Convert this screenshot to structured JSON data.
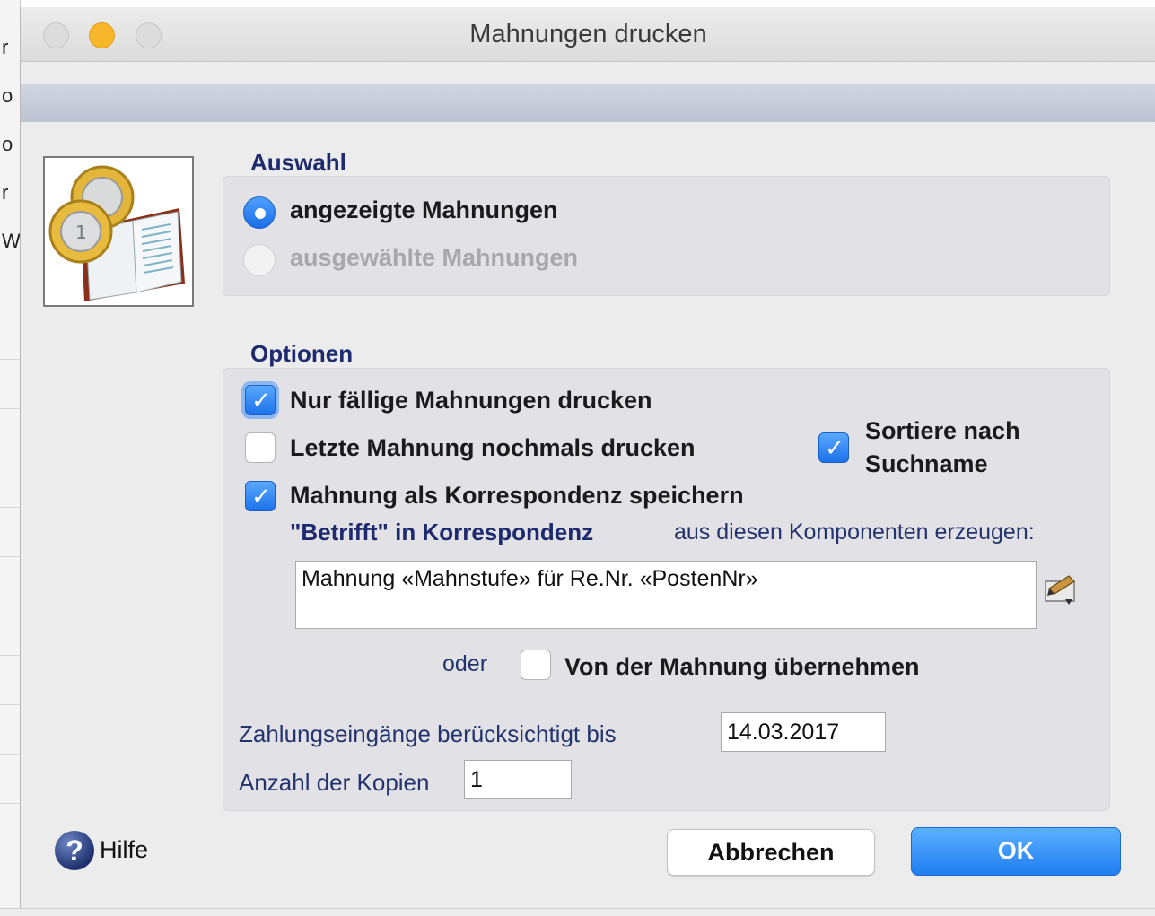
{
  "background_app": {
    "letters": [
      "r",
      "o",
      "o",
      "r",
      "Wi"
    ]
  },
  "window": {
    "title": "Mahnungen drucken"
  },
  "auswahl": {
    "title": "Auswahl",
    "options": [
      {
        "label": "angezeigte Mahnungen",
        "selected": true,
        "enabled": true
      },
      {
        "label": "ausgewählte Mahnungen",
        "selected": false,
        "enabled": false
      }
    ]
  },
  "optionen": {
    "title": "Optionen",
    "nur_faellige": {
      "label": "Nur fällige Mahnungen drucken",
      "checked": true
    },
    "letzte_nochmals": {
      "label": "Letzte Mahnung nochmals drucken",
      "checked": false
    },
    "sortiere": {
      "label_line1": "Sortiere nach",
      "label_line2": "Suchname",
      "checked": true
    },
    "als_korrespondenz": {
      "label": "Mahnung als Korrespondenz speichern",
      "checked": true
    },
    "betrifft_label": "\"Betrifft\" in Korrespondenz",
    "betrifft_suffix": "aus diesen Komponenten erzeugen:",
    "betrifft_value": "Mahnung «Mahnstufe» für Re.Nr. «PostenNr»",
    "oder_label": "oder",
    "von_mahnung": {
      "label": "Von der Mahnung übernehmen",
      "checked": false
    },
    "zahlungseingaenge_label": "Zahlungseingänge berücksichtigt bis",
    "zahlungseingaenge_value": "14.03.2017",
    "kopien_label": "Anzahl der Kopien",
    "kopien_value": "1"
  },
  "footer": {
    "help_label": "Hilfe",
    "cancel_label": "Abbrechen",
    "ok_label": "OK"
  },
  "colors": {
    "accent": "#1f7ef0",
    "section_title": "#1e2a6e"
  }
}
